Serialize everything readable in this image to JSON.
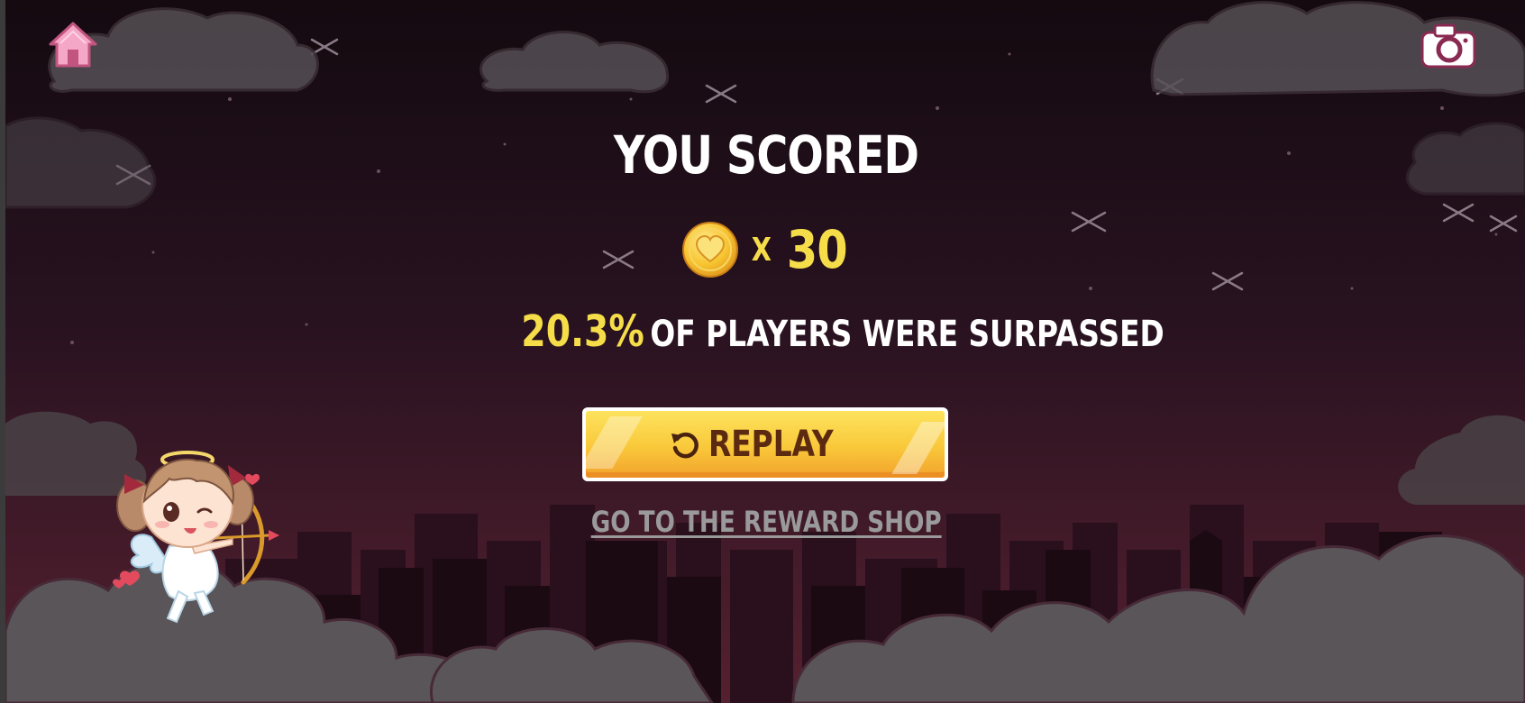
{
  "toolbar": {
    "home_icon": "home-icon",
    "camera_icon": "camera-icon"
  },
  "result": {
    "title": "YOU SCORED",
    "score_multiplier": "X",
    "score_value": "30",
    "coin_icon": "heart-coin-icon",
    "percentile_value": "20.3%",
    "percentile_text": "OF PLAYERS WERE SURPASSED"
  },
  "actions": {
    "replay_label": "REPLAY",
    "replay_icon": "replay-icon",
    "shop_link": "GO TO THE REWARD SHOP"
  },
  "colors": {
    "accent_yellow": "#f5dd4a",
    "button_yellow": "#f9c83a",
    "button_text": "#5b2a10",
    "link_gray": "#9a9a9a",
    "sky_top": "#160b12",
    "sky_bottom": "#4e1d2d",
    "cloud": "#5a5558",
    "home_pink": "#f3a3c4"
  }
}
